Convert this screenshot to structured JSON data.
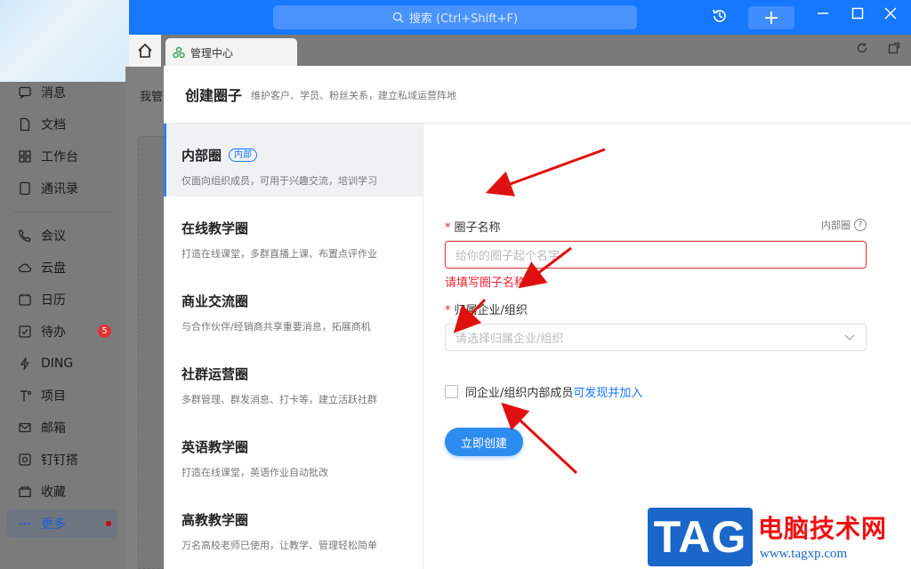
{
  "titlebar": {
    "search_placeholder": "搜索 (Ctrl+Shift+F)",
    "history_icon": "history-icon",
    "add_label": "+",
    "minimize_icon": "minimize-icon",
    "maximize_icon": "maximize-icon",
    "close_icon": "close-icon"
  },
  "tabs": {
    "home_icon": "home-icon",
    "active_tab_label": "管理中心",
    "active_tab_icon": "circle-group-icon"
  },
  "sidebar": {
    "items": [
      {
        "label": "消息",
        "icon": "message-icon"
      },
      {
        "label": "文档",
        "icon": "document-icon"
      },
      {
        "label": "工作台",
        "icon": "grid-icon"
      },
      {
        "label": "通讯录",
        "icon": "contacts-icon"
      },
      {
        "label": "会议",
        "icon": "phone-icon"
      },
      {
        "label": "云盘",
        "icon": "cloud-icon"
      },
      {
        "label": "日历",
        "icon": "calendar-icon"
      },
      {
        "label": "待办",
        "icon": "todo-icon",
        "badge": "5"
      },
      {
        "label": "DING",
        "icon": "ding-icon"
      },
      {
        "label": "项目",
        "icon": "project-icon"
      },
      {
        "label": "邮箱",
        "icon": "mail-icon"
      },
      {
        "label": "钉钉搭",
        "icon": "builder-icon"
      },
      {
        "label": "收藏",
        "icon": "favorite-icon"
      },
      {
        "label": "更多",
        "icon": "more-icon",
        "active": true
      }
    ]
  },
  "background": {
    "label": "我管"
  },
  "modal": {
    "title": "创建圈子",
    "subtitle": "维护客户、学员、粉丝关系，建立私域运营阵地",
    "circle_types": [
      {
        "title": "内部圈",
        "tag": "内部",
        "desc": "仅面向组织成员，可用于兴趣交流，培训学习"
      },
      {
        "title": "在线教学圈",
        "desc": "打造在线课堂，多群直播上课、布置点评作业"
      },
      {
        "title": "商业交流圈",
        "desc": "与合作伙伴/经销商共享重要消息，拓展商机"
      },
      {
        "title": "社群运营圈",
        "desc": "多群管理、群发消息、打卡等，建立活跃社群"
      },
      {
        "title": "英语教学圈",
        "desc": "打造在线课堂，英语作业自动批改"
      },
      {
        "title": "高教教学圈",
        "desc": "万名高校老师已使用，让教学、管理轻松简单"
      }
    ],
    "form": {
      "name_label": "圈子名称",
      "required_mark": "*",
      "type_hint": "内部圈",
      "help_icon": "?",
      "name_placeholder": "给你的圈子起个名字",
      "name_error": "请填写圈子名称",
      "org_label": "归属企业/组织",
      "org_placeholder": "请选择归属企业/组织",
      "checkbox_text": "同企业/组织内部成员",
      "checkbox_link": "可发现并加入",
      "checkbox_checked": false,
      "submit_label": "立即创建"
    }
  },
  "watermark": {
    "logo": "TAG",
    "site_name": "电脑技术网",
    "url": "www.tagxp.com"
  },
  "colors": {
    "brand": "#1677ff",
    "error": "#e23",
    "annotation_arrow": "#e01010"
  }
}
